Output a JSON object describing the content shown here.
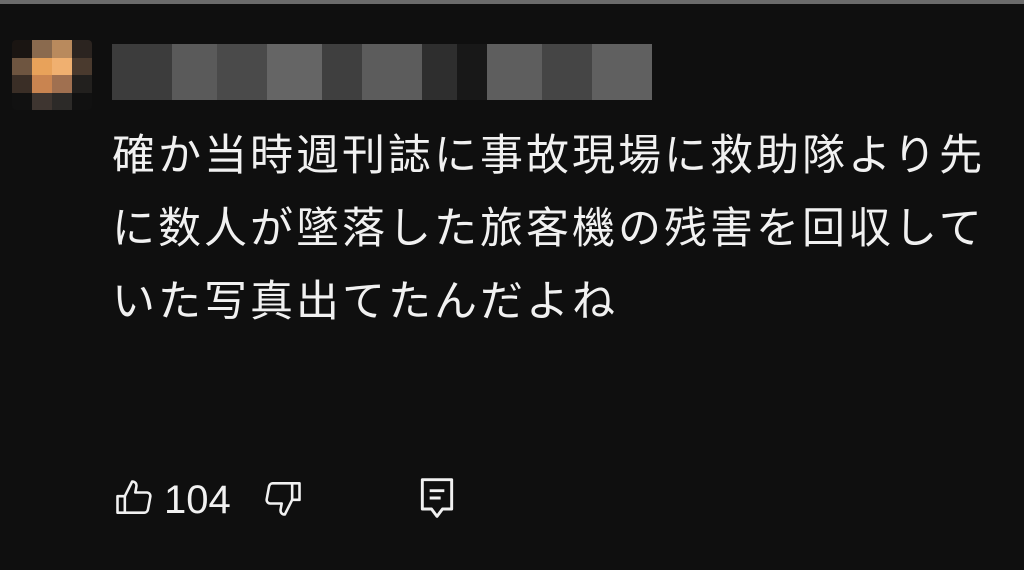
{
  "comment": {
    "text": "確か当時週刊誌に事故現場に救助隊より先に数人が墜落した旅客機の残害を回収していた写真出てたんだよね",
    "likes": "104"
  },
  "icons": {
    "like": "thumbs-up-icon",
    "dislike": "thumbs-down-icon",
    "reply": "reply-comment-icon"
  },
  "colors": {
    "background": "#0f0f0f",
    "text": "#f1f1f1"
  }
}
